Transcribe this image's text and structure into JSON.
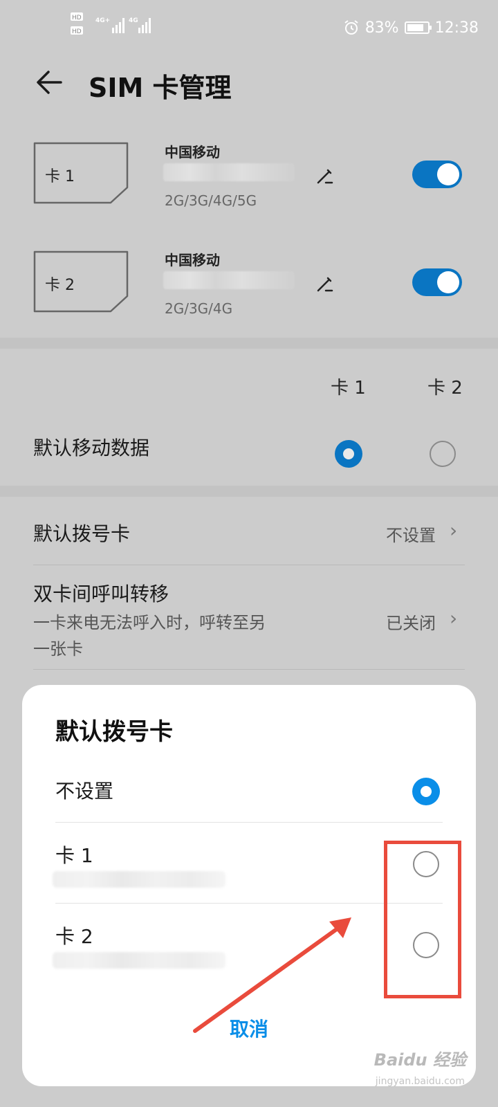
{
  "status_bar": {
    "battery_percent": "83%",
    "battery_level": 0.83,
    "time": "12:38",
    "signal1": "4G⁺",
    "signal2": "4G"
  },
  "header": {
    "title": "SIM 卡管理"
  },
  "sim_cards": [
    {
      "slot_label": "卡 1",
      "carrier": "中国移动",
      "network": "2G/3G/4G/5G",
      "enabled": true
    },
    {
      "slot_label": "卡 2",
      "carrier": "中国移动",
      "network": "2G/3G/4G",
      "enabled": true
    }
  ],
  "columns": {
    "card1": "卡 1",
    "card2": "卡 2"
  },
  "default_data": {
    "label": "默认移动数据",
    "selected": "card1"
  },
  "default_dial": {
    "label": "默认拨号卡",
    "value": "不设置"
  },
  "call_forward": {
    "label": "双卡间呼叫转移",
    "desc_line1": "一卡来电无法呼入时，呼转至另",
    "desc_line2": "一张卡",
    "value": "已关闭"
  },
  "dialog": {
    "title": "默认拨号卡",
    "options": [
      {
        "label": "不设置",
        "selected": true
      },
      {
        "label": "卡 1",
        "selected": false
      },
      {
        "label": "卡 2",
        "selected": false
      }
    ],
    "cancel_label": "取消"
  },
  "watermark": {
    "brand": "Baidu 经验",
    "url": "jingyan.baidu.com"
  },
  "colors": {
    "accent": "#0a75c2",
    "dialog_accent": "#0a8ee8",
    "annotation": "#e94b3c"
  }
}
